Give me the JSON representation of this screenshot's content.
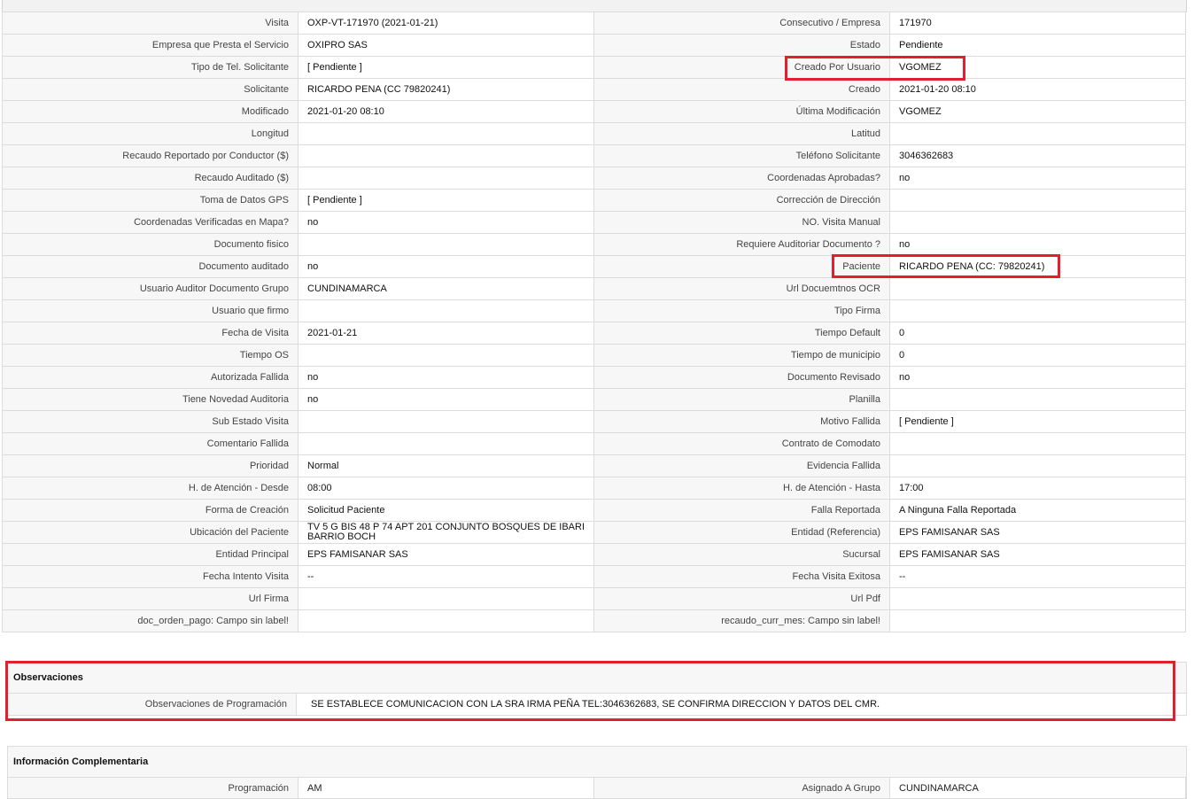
{
  "details": {
    "rows": [
      {
        "l1": "Visita",
        "v1": "OXP-VT-171970 (2021-01-21)",
        "l2": "Consecutivo / Empresa",
        "v2": "171970"
      },
      {
        "l1": "Empresa que Presta el Servicio",
        "v1": "OXIPRO SAS",
        "l2": "Estado",
        "v2": "Pendiente"
      },
      {
        "l1": "Tipo de Tel. Solicitante",
        "v1": "[ Pendiente ]",
        "l2": "Creado Por Usuario",
        "v2": "VGOMEZ"
      },
      {
        "l1": "Solicitante",
        "v1": "RICARDO PENA (CC 79820241)",
        "l2": "Creado",
        "v2": "2021-01-20 08:10"
      },
      {
        "l1": "Modificado",
        "v1": "2021-01-20 08:10",
        "l2": "Última Modificación",
        "v2": " VGOMEZ"
      },
      {
        "l1": "Longitud",
        "v1": "",
        "l2": "Latitud",
        "v2": ""
      },
      {
        "l1": "Recaudo Reportado por Conductor ($)",
        "v1": "",
        "l2": "Teléfono Solicitante",
        "v2": "3046362683"
      },
      {
        "l1": "Recaudo Auditado ($)",
        "v1": "",
        "l2": "Coordenadas Aprobadas?",
        "v2": " no"
      },
      {
        "l1": "Toma de Datos GPS",
        "v1": "[ Pendiente ]",
        "l2": "Corrección de Dirección",
        "v2": ""
      },
      {
        "l1": "Coordenadas Verificadas en Mapa?",
        "v1": " no",
        "l2": "NO. Visita Manual",
        "v2": ""
      },
      {
        "l1": "Documento fisico",
        "v1": "",
        "l2": "Requiere Auditoriar Documento ?",
        "v2": " no"
      },
      {
        "l1": "Documento auditado",
        "v1": " no",
        "l2": "Paciente",
        "v2": "RICARDO PENA (CC: 79820241)"
      },
      {
        "l1": "Usuario Auditor Documento Grupo",
        "v1": "CUNDINAMARCA",
        "l2": "Url Docuemtnos OCR",
        "v2": ""
      },
      {
        "l1": "Usuario que firmo",
        "v1": "",
        "l2": "Tipo Firma",
        "v2": ""
      },
      {
        "l1": "Fecha de Visita",
        "v1": " 2021-01-21",
        "l2": "Tiempo Default",
        "v2": "0"
      },
      {
        "l1": "Tiempo OS",
        "v1": "",
        "l2": "Tiempo de municipio",
        "v2": "0"
      },
      {
        "l1": "Autorizada Fallida",
        "v1": " no",
        "l2": "Documento Revisado",
        "v2": " no"
      },
      {
        "l1": "Tiene Novedad Auditoria",
        "v1": " no",
        "l2": "Planilla",
        "v2": ""
      },
      {
        "l1": "Sub Estado Visita",
        "v1": "",
        "l2": "Motivo Fallida",
        "v2": "[ Pendiente ]"
      },
      {
        "l1": "Comentario Fallida",
        "v1": "",
        "l2": "Contrato de Comodato",
        "v2": ""
      },
      {
        "l1": "Prioridad",
        "v1": "Normal",
        "l2": "Evidencia Fallida",
        "v2": ""
      },
      {
        "l1": "H. de Atención - Desde",
        "v1": "08:00",
        "l2": "H. de Atención - Hasta",
        "v2": "17:00"
      },
      {
        "l1": "Forma de Creación",
        "v1": "Solicitud Paciente",
        "l2": "Falla Reportada",
        "v2": "A Ninguna Falla Reportada"
      },
      {
        "l1": "Ubicación del Paciente",
        "v1": "TV 5 G BIS 48 P 74 APT 201 CONJUNTO BOSQUES DE IBARI BARRIO BOCH",
        "l2": "Entidad (Referencia)",
        "v2": "EPS FAMISANAR SAS"
      },
      {
        "l1": "Entidad Principal",
        "v1": "EPS FAMISANAR SAS",
        "l2": "Sucursal",
        "v2": "EPS FAMISANAR SAS"
      },
      {
        "l1": "Fecha Intento Visita",
        "v1": "--",
        "l2": "Fecha Visita Exitosa",
        "v2": " --"
      },
      {
        "l1": "Url Firma",
        "v1": "",
        "l2": "Url Pdf",
        "v2": ""
      },
      {
        "l1": "doc_orden_pago: Campo sin label!",
        "v1": "",
        "l2": "recaudo_curr_mes: Campo sin label!",
        "v2": ""
      }
    ]
  },
  "observaciones": {
    "title": "Observaciones",
    "label": "Observaciones de Programación",
    "value": "SE ESTABLECE COMUNICACION CON LA SRA IRMA PEÑA TEL:3046362683, SE CONFIRMA DIRECCION Y DATOS DEL CMR."
  },
  "complementaria": {
    "title": "Información Complementaria",
    "l1": "Programación",
    "v1": "AM",
    "l2": "Asignado A Grupo",
    "v2": "CUNDINAMARCA"
  },
  "highlight_color": "#e0202e"
}
